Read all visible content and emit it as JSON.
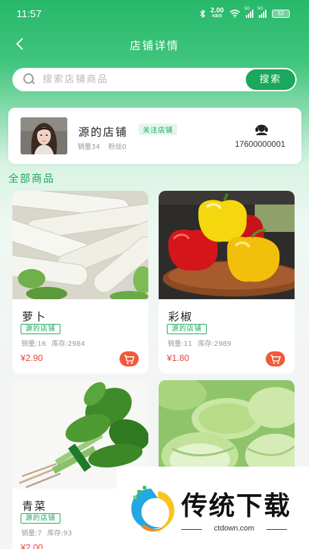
{
  "status": {
    "time": "11:57",
    "speed": "2.00",
    "speed_unit": "KB/S",
    "sig1": "5G",
    "sig2": "5G",
    "battery": "52"
  },
  "header": {
    "title": "店铺详情"
  },
  "search": {
    "placeholder": "搜索店铺商品",
    "button": "搜索"
  },
  "store": {
    "name": "源的店铺",
    "follow": "关注店铺",
    "sales": "销量34",
    "fans": "粉丝0",
    "phone": "17600000001"
  },
  "section_title": "全部商品",
  "products": [
    {
      "name": "萝卜",
      "store_tag": "源的店铺",
      "sales": "销量:16",
      "stock": "库存:2984",
      "price": "¥2.90"
    },
    {
      "name": "彩椒",
      "store_tag": "源的店铺",
      "sales": "销量:11",
      "stock": "库存:2989",
      "price": "¥1.80"
    },
    {
      "name": "青菜",
      "store_tag": "源的店铺",
      "sales": "销量:7",
      "stock": "库存:93",
      "price": "¥2.00"
    },
    {
      "name": "",
      "store_tag": "",
      "sales": "",
      "stock": "",
      "price": ""
    }
  ],
  "watermark": {
    "text": "传统下载",
    "sub": "ctdown.com"
  },
  "colors": {
    "brand": "#1aa85a",
    "price": "#e8463c",
    "cart": "#f05a3b"
  }
}
